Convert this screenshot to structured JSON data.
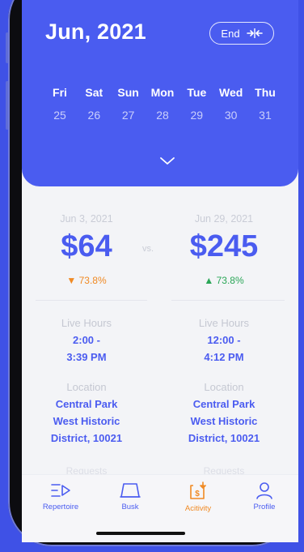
{
  "header": {
    "month": "Jun, 2021",
    "end_label": "End",
    "days": [
      {
        "name": "Fri",
        "date": "25"
      },
      {
        "name": "Sat",
        "date": "26"
      },
      {
        "name": "Sun",
        "date": "27"
      },
      {
        "name": "Mon",
        "date": "28"
      },
      {
        "name": "Tue",
        "date": "29"
      },
      {
        "name": "Wed",
        "date": "30"
      },
      {
        "name": "Thu",
        "date": "31"
      }
    ]
  },
  "comparison": {
    "vs_label": "vs.",
    "left": {
      "date": "Jun 3, 2021",
      "amount": "$64",
      "change": "73.8%",
      "hours_label": "Live Hours",
      "hours": [
        "2:00 -",
        "3:39 PM"
      ],
      "location_label": "Location",
      "location": [
        "Central Park",
        "West Historic",
        "District, 10021"
      ],
      "requests_label": "Requests"
    },
    "right": {
      "date": "Jun 29, 2021",
      "amount": "$245",
      "change": "73.8%",
      "hours_label": "Live Hours",
      "hours": [
        "12:00 -",
        "4:12 PM"
      ],
      "location_label": "Location",
      "location": [
        "Central Park",
        "West Historic",
        "District, 10021"
      ],
      "requests_label": "Requests"
    }
  },
  "tabs": [
    {
      "label": "Repertoire",
      "icon": "repertoire-icon"
    },
    {
      "label": "Busk",
      "icon": "busk-icon"
    },
    {
      "label": "Acitivity",
      "icon": "activity-icon"
    },
    {
      "label": "Profile",
      "icon": "profile-icon"
    }
  ],
  "colors": {
    "primary": "#4a5cf0",
    "accent": "#f08a24",
    "positive": "#2aa657",
    "background": "#3f51e6"
  }
}
